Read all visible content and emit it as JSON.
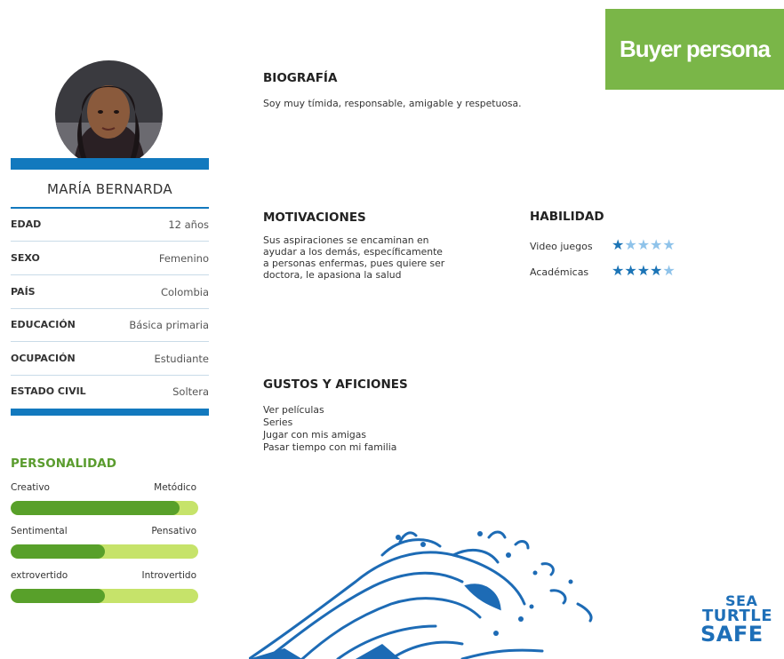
{
  "header": {
    "title": "Buyer persona"
  },
  "profile": {
    "name": "MARÍA BERNARDA",
    "fields": [
      {
        "label": "EDAD",
        "value": "12 años"
      },
      {
        "label": "SEXO",
        "value": "Femenino"
      },
      {
        "label": "PAÍS",
        "value": "Colombia"
      },
      {
        "label": "EDUCACIÓN",
        "value": "Básica primaria"
      },
      {
        "label": "OCUPACIÓN",
        "value": "Estudiante"
      },
      {
        "label": "ESTADO CIVIL",
        "value": "Soltera"
      }
    ]
  },
  "personality": {
    "title": "PERSONALIDAD",
    "traits": [
      {
        "left": "Creativo",
        "right": "Metódico",
        "level": 0.9
      },
      {
        "left": "Sentimental",
        "right": "Pensativo",
        "level": 0.5
      },
      {
        "left": "extrovertido",
        "right": "Introvertido",
        "level": 0.5
      }
    ]
  },
  "biography": {
    "title": "BIOGRAFÍA",
    "text": "Soy muy tímida, responsable, amigable y respetuosa."
  },
  "motivations": {
    "title": "MOTIVACIONES",
    "lines": [
      "Sus aspiraciones se encaminan en",
      "ayudar a los demás, específicamente",
      "a personas enfermas, pues quiere ser",
      "doctora, le apasiona la salud"
    ]
  },
  "skills": {
    "title": "HABILIDAD",
    "items": [
      {
        "label": "Video juegos",
        "rating": 1,
        "max": 5
      },
      {
        "label": "Académicas",
        "rating": 4,
        "max": 5
      }
    ]
  },
  "hobbies": {
    "title": "GUSTOS Y AFICIONES",
    "items": [
      "Ver películas",
      "Series",
      "Jugar con mis amigas",
      "Pasar tiempo con mi familia"
    ]
  },
  "logo": {
    "line1": "SEA",
    "line2": "TURTLE",
    "line3": "SAFE"
  },
  "colors": {
    "brand_green": "#7ab648",
    "accent_blue": "#1279be",
    "bar_dark": "#58a02a",
    "bar_light": "#c6e36a"
  }
}
